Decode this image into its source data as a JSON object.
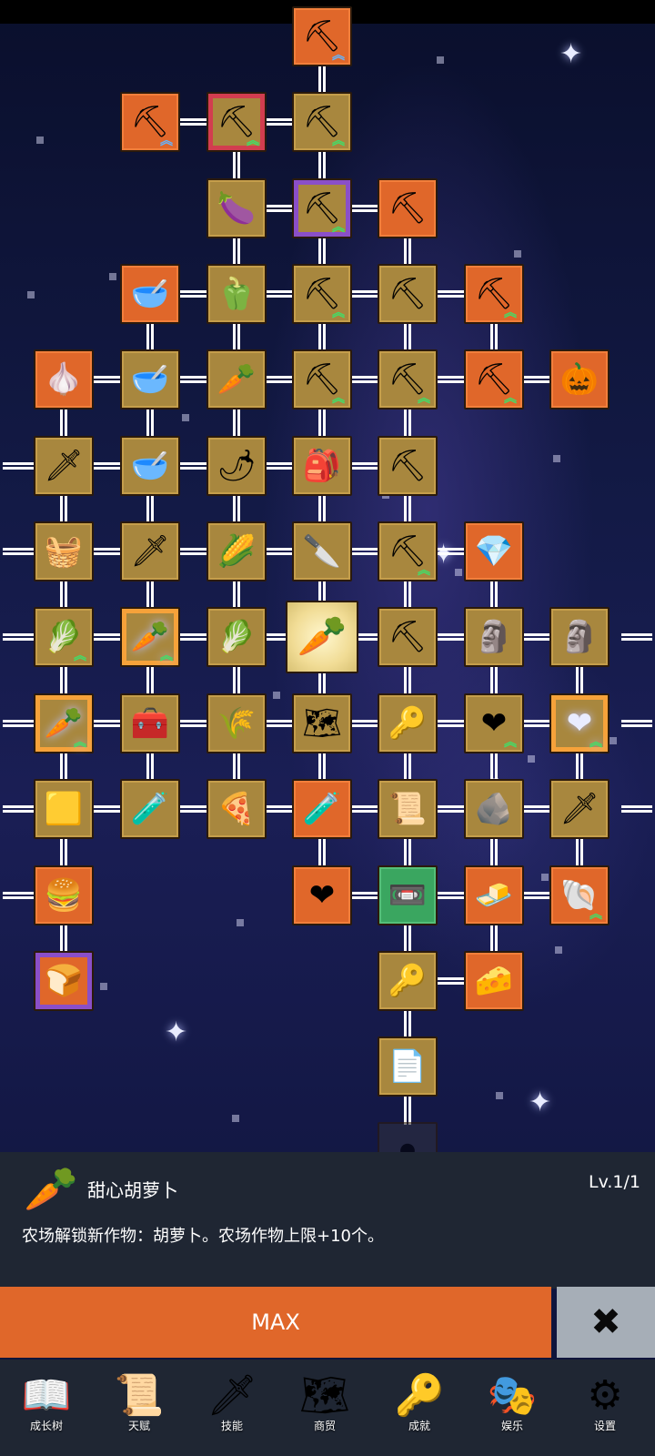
{
  "colors": {
    "node_gold": "#a8873e",
    "node_orange": "#e0672a",
    "node_green": "#3aa660",
    "max_button": "#e0672a",
    "close_button": "#a6aeb7",
    "panel_bg": "#1f2633"
  },
  "tree_nodes": [
    {
      "id": "shovel-top",
      "icon": "shovel-icon",
      "style": "orange",
      "arrows": "blue"
    },
    {
      "id": "shovel-left",
      "icon": "shovel-icon",
      "style": "orange",
      "arrows": "blue"
    },
    {
      "id": "shovel-mid",
      "icon": "shovel-icon",
      "style": "gold",
      "arrows": "green"
    },
    {
      "id": "shovel-right",
      "icon": "shovel-icon",
      "style": "gold",
      "arrows": "green"
    },
    {
      "id": "eggplant",
      "icon": "eggplant-icon",
      "style": "gold",
      "arrows": "none"
    },
    {
      "id": "shovel-purple",
      "icon": "shovel-icon",
      "style": "gold",
      "arrows": "green"
    },
    {
      "id": "pickaxe-gold",
      "icon": "pickaxe-icon",
      "style": "orange",
      "arrows": "none"
    },
    {
      "id": "bowl-1",
      "icon": "bowl-icon",
      "style": "orange",
      "arrows": "none"
    },
    {
      "id": "pepper",
      "icon": "bell-pepper-icon",
      "style": "gold",
      "arrows": "none"
    },
    {
      "id": "shovel-r4",
      "icon": "shovel-icon",
      "style": "gold",
      "arrows": "green"
    },
    {
      "id": "pickaxe-r4",
      "icon": "pickaxe-icon",
      "style": "gold",
      "arrows": "none"
    },
    {
      "id": "pickaxe-green-r4",
      "icon": "pickaxe-icon",
      "style": "orange",
      "arrows": "green"
    },
    {
      "id": "garlic",
      "icon": "garlic-icon",
      "style": "orange",
      "arrows": "none"
    },
    {
      "id": "bowl-2",
      "icon": "bowl-icon",
      "style": "gold",
      "arrows": "none"
    },
    {
      "id": "radish",
      "icon": "radish-icon",
      "style": "gold",
      "arrows": "none"
    },
    {
      "id": "shovel-r5",
      "icon": "shovel-icon",
      "style": "gold",
      "arrows": "green"
    },
    {
      "id": "pickaxe-r5",
      "icon": "pickaxe-icon",
      "style": "gold",
      "arrows": "green"
    },
    {
      "id": "pickaxe-green-r5",
      "icon": "pickaxe-icon",
      "style": "orange",
      "arrows": "green"
    },
    {
      "id": "scarecrow",
      "icon": "scarecrow-icon",
      "style": "orange",
      "arrows": "none"
    },
    {
      "id": "sword-gold",
      "icon": "sword-icon",
      "style": "gold",
      "arrows": "none"
    },
    {
      "id": "bowl-3",
      "icon": "bowl-icon",
      "style": "gold",
      "arrows": "none"
    },
    {
      "id": "chili",
      "icon": "chili-icon",
      "style": "gold",
      "arrows": "none"
    },
    {
      "id": "backpack",
      "icon": "backpack-icon",
      "style": "gold",
      "arrows": "none"
    },
    {
      "id": "pickaxe-green-r6",
      "icon": "pickaxe-icon",
      "style": "gold",
      "arrows": "none"
    },
    {
      "id": "basket",
      "icon": "basket-icon",
      "style": "gold",
      "arrows": "none"
    },
    {
      "id": "sword-iron",
      "icon": "sword-icon",
      "style": "gold",
      "arrows": "none"
    },
    {
      "id": "corn",
      "icon": "corn-icon",
      "style": "gold",
      "arrows": "none"
    },
    {
      "id": "dagger",
      "icon": "dagger-icon",
      "style": "gold",
      "arrows": "none"
    },
    {
      "id": "pickaxe-r7",
      "icon": "pickaxe-icon",
      "style": "gold",
      "arrows": "green"
    },
    {
      "id": "crystal",
      "icon": "crystal-icon",
      "style": "orange",
      "arrows": "none"
    },
    {
      "id": "cabbage-1",
      "icon": "cabbage-icon",
      "style": "gold",
      "arrows": "green"
    },
    {
      "id": "carrot-upgrade",
      "icon": "carrot-icon",
      "style": "gold",
      "arrows": "green"
    },
    {
      "id": "cabbage-2",
      "icon": "cabbage-icon",
      "style": "gold",
      "arrows": "none"
    },
    {
      "id": "carrot-selected",
      "icon": "carrot-icon",
      "style": "cream",
      "arrows": "none"
    },
    {
      "id": "pickaxe-r8",
      "icon": "pickaxe-icon",
      "style": "gold",
      "arrows": "none"
    },
    {
      "id": "statue-1",
      "icon": "statue-icon",
      "style": "gold",
      "arrows": "none"
    },
    {
      "id": "statue-2",
      "icon": "statue-icon",
      "style": "gold",
      "arrows": "none"
    },
    {
      "id": "carrot-boost",
      "icon": "carrot-icon",
      "style": "gold",
      "arrows": "green"
    },
    {
      "id": "chest",
      "icon": "chest-icon",
      "style": "gold",
      "arrows": "none"
    },
    {
      "id": "wheat",
      "icon": "wheat-icon",
      "style": "gold",
      "arrows": "none"
    },
    {
      "id": "map",
      "icon": "map-icon",
      "style": "gold",
      "arrows": "none"
    },
    {
      "id": "key-gold",
      "icon": "key-icon",
      "style": "gold",
      "arrows": "none"
    },
    {
      "id": "heart-1",
      "icon": "heart-icon",
      "style": "gold",
      "arrows": "green"
    },
    {
      "id": "heart-2",
      "icon": "heart-icon",
      "style": "gold",
      "arrows": "green"
    },
    {
      "id": "gold-bar",
      "icon": "gold-bar-icon",
      "style": "gold",
      "arrows": "none"
    },
    {
      "id": "potion-yellow",
      "icon": "potion-icon",
      "style": "gold",
      "arrows": "none"
    },
    {
      "id": "pizza",
      "icon": "pizza-icon",
      "style": "gold",
      "arrows": "none"
    },
    {
      "id": "potion-green",
      "icon": "potion-icon",
      "style": "orange",
      "arrows": "none"
    },
    {
      "id": "scroll",
      "icon": "scroll-icon",
      "style": "gold",
      "arrows": "none"
    },
    {
      "id": "stone",
      "icon": "stone-icon",
      "style": "gold",
      "arrows": "none"
    },
    {
      "id": "sword-wood",
      "icon": "sword-icon",
      "style": "gold",
      "arrows": "none"
    },
    {
      "id": "burger",
      "icon": "burger-icon",
      "style": "orange",
      "arrows": "none"
    },
    {
      "id": "heart-3",
      "icon": "heart-icon",
      "style": "orange",
      "arrows": "none"
    },
    {
      "id": "cassette",
      "icon": "cassette-icon",
      "style": "green",
      "arrows": "none"
    },
    {
      "id": "butter",
      "icon": "butter-icon",
      "style": "orange",
      "arrows": "none"
    },
    {
      "id": "fossil",
      "icon": "fossil-icon",
      "style": "orange",
      "arrows": "green"
    },
    {
      "id": "bread-card",
      "icon": "bread-icon",
      "style": "orange",
      "arrows": "none"
    },
    {
      "id": "key-iron",
      "icon": "key-icon",
      "style": "gold",
      "arrows": "none"
    },
    {
      "id": "cheese",
      "icon": "cheese-icon",
      "style": "orange",
      "arrows": "none"
    },
    {
      "id": "parchment",
      "icon": "parchment-icon",
      "style": "gold",
      "arrows": "none"
    },
    {
      "id": "rock-locked",
      "icon": "rock-icon",
      "style": "dim",
      "arrows": "none"
    }
  ],
  "selected_item": {
    "icon": "carrot-icon",
    "name": "甜心胡萝卜",
    "level": "Lv.1/1",
    "description": "农场解锁新作物：胡萝卜。农场作物上限+10个。"
  },
  "buttons": {
    "max_label": "MAX",
    "close_icon": "close-icon"
  },
  "nav": [
    {
      "id": "growth-tree",
      "label": "成长树",
      "icon": "book-icon"
    },
    {
      "id": "talent",
      "label": "天赋",
      "icon": "scroll-icon"
    },
    {
      "id": "skills",
      "label": "技能",
      "icon": "sword-icon"
    },
    {
      "id": "trade",
      "label": "商贸",
      "icon": "map-icon"
    },
    {
      "id": "achievements",
      "label": "成就",
      "icon": "key-icon"
    },
    {
      "id": "entertainment",
      "label": "娱乐",
      "icon": "entertainment-icon"
    },
    {
      "id": "settings",
      "label": "设置",
      "icon": "gear-icon"
    }
  ]
}
